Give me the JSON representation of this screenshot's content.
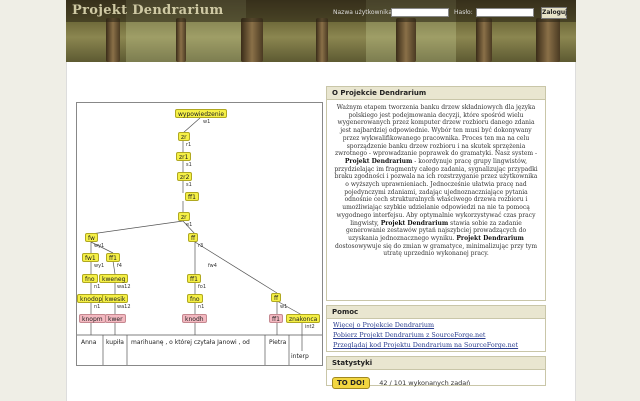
{
  "header": {
    "logo": "Projekt Dendrarium",
    "username_label": "Nazwa użytkownika:",
    "password_label": "Hasło:",
    "login_button": "Zaloguj"
  },
  "tree": {
    "nodes": [
      "wypowiedzenie",
      "zr",
      "zr1",
      "zr2",
      "zr",
      "ff",
      "fw",
      "ff1",
      "fw1",
      "ff1",
      "fno",
      "kweneg",
      "ff1",
      "fno",
      "ff",
      "knodop",
      "kwesik",
      "knodop",
      "ff1",
      "znakonca"
    ],
    "edge_labels": [
      "w1",
      "r1",
      "s1",
      "s1",
      "e1",
      "r1",
      "r3",
      "wy1",
      "f4",
      "wa12",
      "k4",
      "ffn3",
      "n1",
      "w1",
      "n1",
      "fo1",
      "n1",
      "wy4",
      "int2",
      "fw4"
    ],
    "leaves": [
      "Anna",
      "kupiła",
      "marihuanę , o której czytała Janowi , od",
      "Pietra",
      "interp"
    ],
    "leaf_tags": [
      "knopm",
      "kwer",
      "knodh",
      "ff1"
    ]
  },
  "about": {
    "title": "O Projekcie Dendrarium",
    "p1": "Ważnym etapem tworzenia banku drzew składniowych dla języka polskiego jest podejmowania decyzji, które spośród wielu wygenerowanych przez komputer drzew rozbioru danego zdania jest najbardziej odpowiednie. Wybór ten musi być dokonywany przez wykwalifikowanego pracownika. Proces ten ma na celu sporządzenie banku drzew rozbioru i na skutek sprzężenia zwrotnego - wprowadzanie poprawek do gramatyki. Nasz system -",
    "name": "Projekt Dendrarium",
    "p2": "- koordynuje pracę grupy lingwistów, przydzielając im fragmenty całego zadania, sygnalizując przypadki braku zgodności i pozwala na ich rozstrzyganie przez użytkownika o wyższych uprawnieniach. Jednocześnie ułatwia pracę nad pojedynczymi zdaniami, zadając ujednoznaczniające pytania odnośnie cech strukturalnych właściwego drzewa rozbioru i umożliwiając szybkie udzielanie odpowiedzi na nie ta pomocą wygodnego interfejsu. Aby optymalnie wykorzystywać czas pracy lingwisty,",
    "p3": "stawia sobie za zadanie generowanie zestawów pytań najszybciej prowadzących do uzyskania jednoznacznego wyniku.",
    "p4": "dostosowywuje się do zmian w gramatyce, minimalizując przy tym utratę uprzednio wykonanej pracy."
  },
  "help": {
    "title": "Pomoc",
    "links": [
      "Więcej o Projekcie Dendrarium",
      "Pobierz Projekt Dendrarium z SourceForge.net",
      "Przeglądaj kod Projektu Dendrarium na SourceForge.net"
    ]
  },
  "stats": {
    "title": "Statystyki",
    "badge": "TO DO!",
    "progress_text": "42 / 101 wykonanych zadań",
    "done": 42,
    "total": 101
  }
}
